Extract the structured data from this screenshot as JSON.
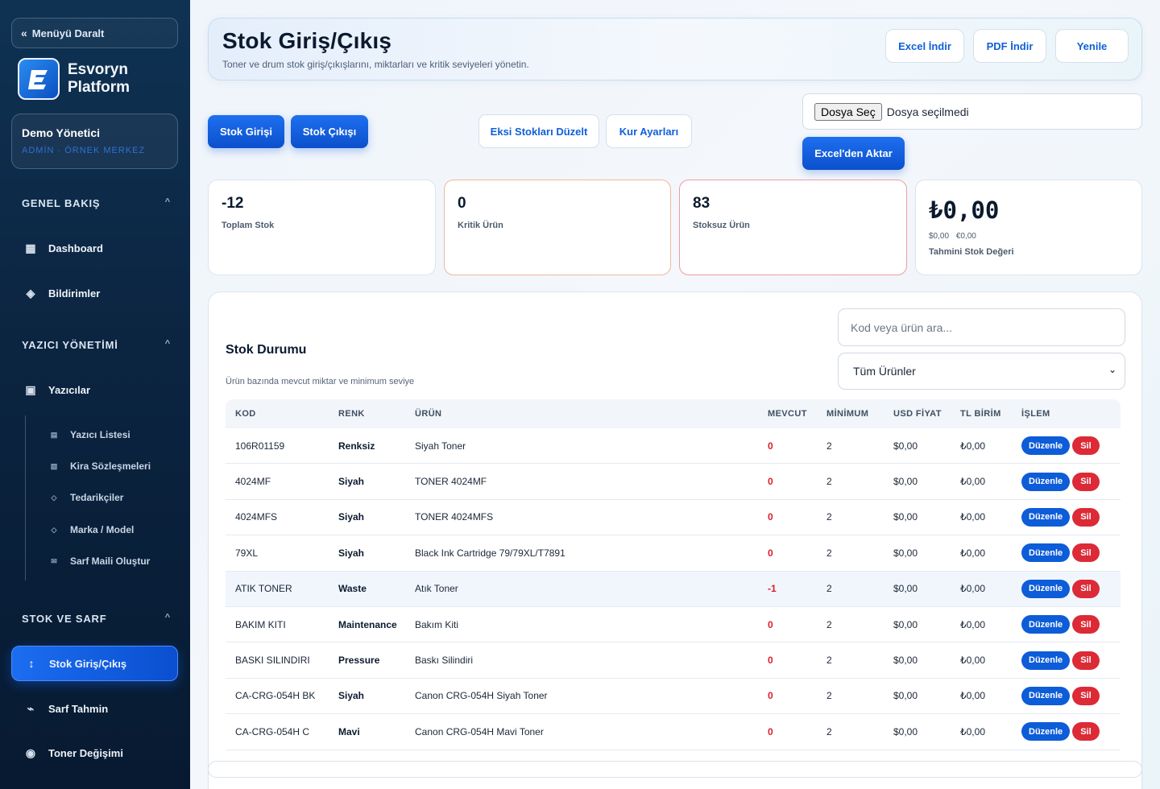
{
  "sidebar": {
    "collapse_label": "Menüyü Daralt",
    "brand_line1": "Esvoryn",
    "brand_line2": "Platform",
    "user_name": "Demo Yönetici",
    "user_role": "ADMİN · ÖRNEK MERKEZ",
    "sections": {
      "overview": "GENEL BAKIŞ",
      "printers": "YAZICI YÖNETİMİ",
      "stock": "STOK VE SARF"
    },
    "items": {
      "dashboard": "Dashboard",
      "notifications": "Bildirimler",
      "printers": "Yazıcılar",
      "printer_list": "Yazıcı Listesi",
      "leases": "Kira Sözleşmeleri",
      "suppliers": "Tedarikçiler",
      "brand_model": "Marka / Model",
      "consumable_mail": "Sarf Maili Oluştur",
      "stock_io": "Stok Giriş/Çıkış",
      "consumable_forecast": "Sarf Tahmin",
      "toner_change": "Toner Değişimi"
    }
  },
  "header": {
    "title": "Stok Giriş/Çıkış",
    "subtitle": "Toner ve drum stok giriş/çıkışlarını, miktarları ve kritik seviyeleri yönetin.",
    "excel_label": "Excel İndir",
    "pdf_label": "PDF İndir",
    "refresh_label": "Yenile"
  },
  "actions": {
    "stock_in": "Stok Girişi",
    "stock_out": "Stok Çıkışı",
    "fix_negative": "Eksi Stokları Düzelt",
    "currency_settings": "Kur Ayarları",
    "file_button": "Dosya Seç",
    "file_status": "Dosya seçilmedi",
    "import_excel": "Excel'den Aktar"
  },
  "stats": {
    "total_value": "-12",
    "total_label": "Toplam Stok",
    "critical_value": "0",
    "critical_label": "Kritik Ürün",
    "out_value": "83",
    "out_label": "Stoksuz Ürün",
    "worth_value": "₺0,00",
    "worth_usd": "$0,00",
    "worth_eur": "€0,00",
    "worth_label": "Tahmini Stok Değeri"
  },
  "table": {
    "title": "Stok Durumu",
    "subtitle": "Ürün bazında mevcut miktar ve minimum seviye",
    "search_placeholder": "Kod veya ürün ara...",
    "filter_value": "Tüm Ürünler",
    "edit_label": "Düzenle",
    "delete_label": "Sil",
    "columns": [
      "KOD",
      "RENK",
      "ÜRÜN",
      "MEVCUT",
      "MİNİMUM",
      "USD FİYAT",
      "TL BİRİM",
      "İŞLEM"
    ],
    "rows": [
      {
        "kod": "106R01159",
        "renk": "Renksiz",
        "urun": "Siyah Toner",
        "mevcut": "0",
        "minimum": "2",
        "usd": "$0,00",
        "tl": "₺0,00"
      },
      {
        "kod": "4024MF",
        "renk": "Siyah",
        "urun": "TONER 4024MF",
        "mevcut": "0",
        "minimum": "2",
        "usd": "$0,00",
        "tl": "₺0,00"
      },
      {
        "kod": "4024MFS",
        "renk": "Siyah",
        "urun": "TONER 4024MFS",
        "mevcut": "0",
        "minimum": "2",
        "usd": "$0,00",
        "tl": "₺0,00"
      },
      {
        "kod": "79XL",
        "renk": "Siyah",
        "urun": "Black Ink Cartridge 79/79XL/T7891",
        "mevcut": "0",
        "minimum": "2",
        "usd": "$0,00",
        "tl": "₺0,00"
      },
      {
        "kod": "ATIK TONER",
        "renk": "Waste",
        "urun": "Atık Toner",
        "mevcut": "-1",
        "minimum": "2",
        "usd": "$0,00",
        "tl": "₺0,00"
      },
      {
        "kod": "BAKIM KITI",
        "renk": "Maintenance",
        "urun": "Bakım Kiti",
        "mevcut": "0",
        "minimum": "2",
        "usd": "$0,00",
        "tl": "₺0,00"
      },
      {
        "kod": "BASKI SILINDIRI",
        "renk": "Pressure",
        "urun": "Baskı Silindiri",
        "mevcut": "0",
        "minimum": "2",
        "usd": "$0,00",
        "tl": "₺0,00"
      },
      {
        "kod": "CA-CRG-054H BK",
        "renk": "Siyah",
        "urun": "Canon CRG-054H Siyah Toner",
        "mevcut": "0",
        "minimum": "2",
        "usd": "$0,00",
        "tl": "₺0,00"
      },
      {
        "kod": "CA-CRG-054H C",
        "renk": "Mavi",
        "urun": "Canon CRG-054H Mavi Toner",
        "mevcut": "0",
        "minimum": "2",
        "usd": "$0,00",
        "tl": "₺0,00"
      }
    ]
  },
  "colors": {
    "accent": "#0d5cd8",
    "danger": "#dc2a36",
    "sidebar": "#0b2440"
  }
}
